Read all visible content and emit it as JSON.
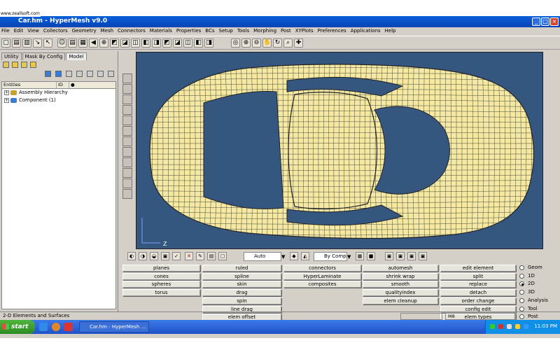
{
  "window": {
    "title": "Car.hm - HyperMesh v9.0",
    "watermark": "www.zeallsoft.com",
    "buttons": [
      "_",
      "□",
      "×"
    ]
  },
  "menu": [
    "File",
    "Edit",
    "View",
    "Collectors",
    "Geometry",
    "Mesh",
    "Connectors",
    "Materials",
    "Properties",
    "BCs",
    "Setup",
    "Tools",
    "Morphing",
    "Post",
    "XYPlots",
    "Preferences",
    "Applications",
    "Help"
  ],
  "left_panel": {
    "tabs": [
      "Utility",
      "Mask By Config",
      "Model"
    ],
    "active_tab": "Model",
    "columns": [
      "Entities",
      "ID"
    ],
    "tree": [
      {
        "label": "Assembly Hierarchy",
        "expander": "+"
      },
      {
        "label": "Component (1)",
        "expander": "+"
      }
    ]
  },
  "viewport": {
    "background": "#35577f",
    "mesh_color": "#f4e8a2",
    "axis_label": "Z"
  },
  "bottom_toolbar": {
    "auto_dropdown": "Auto",
    "bycomp_dropdown": "By Comp"
  },
  "panel_columns": [
    [
      "planes",
      "cones",
      "spheres",
      "torus"
    ],
    [
      "ruled",
      "spline",
      "skin",
      "drag",
      "spin",
      "line drag",
      "elem offset"
    ],
    [
      "connectors",
      "HyperLaminate",
      "composites"
    ],
    [
      "automesh",
      "shrink wrap",
      "smooth",
      "qualityindex",
      "elem cleanup"
    ],
    [
      "edit element",
      "split",
      "replace",
      "detach",
      "order change",
      "config edit",
      "elem types"
    ]
  ],
  "page_radios": [
    {
      "label": "Geom",
      "selected": false
    },
    {
      "label": "1D",
      "selected": false
    },
    {
      "label": "2D",
      "selected": true
    },
    {
      "label": "3D",
      "selected": false
    },
    {
      "label": "Analysis",
      "selected": false
    },
    {
      "label": "Tool",
      "selected": false
    },
    {
      "label": "Post",
      "selected": false
    }
  ],
  "status": {
    "message": "2-D Elements and Surfaces",
    "m_box": "M8"
  },
  "taskbar": {
    "start": "start",
    "task": "Car.hm - HyperMesh ...",
    "clock": "11:03 PM"
  }
}
